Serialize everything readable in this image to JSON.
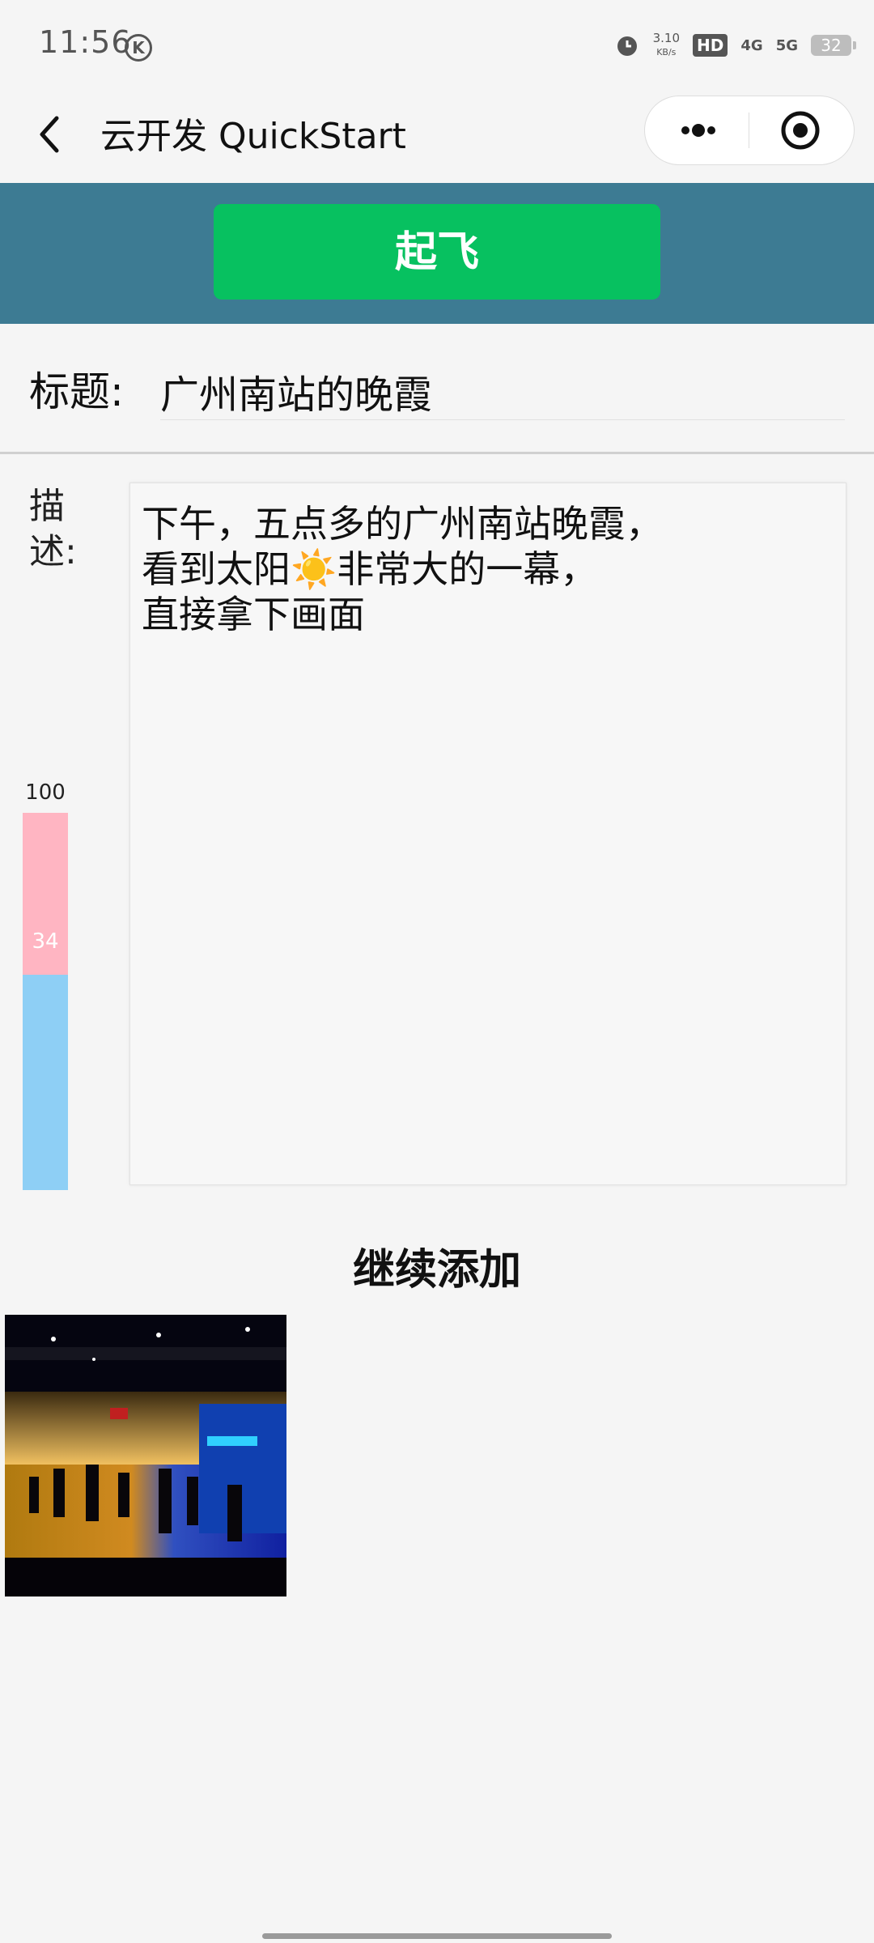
{
  "status_bar": {
    "time": "11:56",
    "k_badge": "K",
    "net_speed": "3.10",
    "net_unit": "KB/s",
    "hd": "HD",
    "signal_4g": "4G",
    "signal_5g": "5G",
    "battery": "32"
  },
  "nav": {
    "title": "云开发 QuickStart"
  },
  "hero": {
    "button_label": "起飞"
  },
  "form": {
    "title_label": "标题:",
    "title_value": "广州南站的晚霞",
    "desc_label": "描述:",
    "desc_lines": [
      "下午，五点多的广州南站晚霞，",
      "看到太阳☀️非常大的一幕，",
      "直接拿下画面"
    ]
  },
  "progress": {
    "max": "100",
    "value": "34",
    "fraction": 0.43
  },
  "continue_label": "继续添加",
  "colors": {
    "hero_bg": "#3d7b93",
    "button": "#07c160",
    "bar_fill": "#ffb5c2",
    "bar_bg": "#8ecff5"
  }
}
